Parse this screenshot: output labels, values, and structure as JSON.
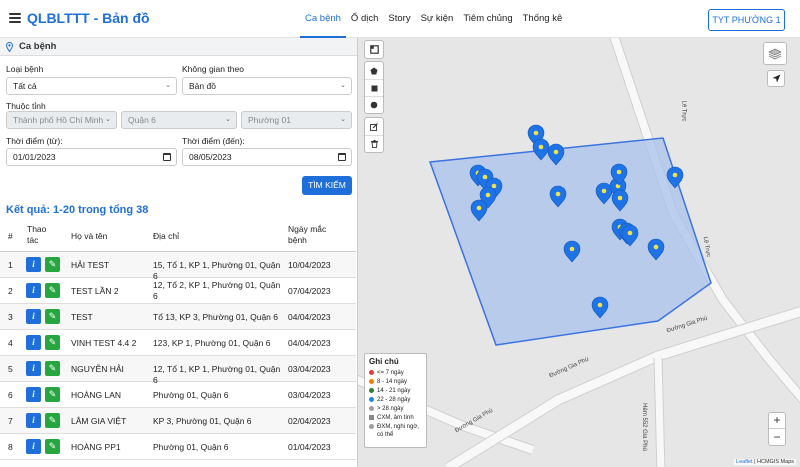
{
  "header": {
    "title": "QLBLTTT - Bản đồ",
    "nav": [
      "Ca bệnh",
      "Ổ dịch",
      "Story",
      "Sự kiện",
      "Tiêm chủng",
      "Thống kê"
    ],
    "active_tab": "Ca bệnh",
    "unit_button": "TYT PHƯỜNG 1"
  },
  "panel": {
    "title": "Ca bệnh",
    "loai_benh_label": "Loại bệnh",
    "loai_benh_value": "Tất cả",
    "khong_gian_label": "Không gian theo",
    "khong_gian_value": "Bản đồ",
    "tinh_label": "Thuộc tỉnh",
    "tinh_value": "Thành phố Hồ Chí Minh",
    "quan_value": "Quận 6",
    "phuong_value": "Phường 01",
    "tu_label": "Thời điểm (từ):",
    "tu_value": "01/01/2023",
    "den_label": "Thời điểm (đến):",
    "den_value": "08/05/2023",
    "search_button": "TÌM KIẾM",
    "result_text": "Kết quả: 1-20 trong tổng 38"
  },
  "table": {
    "headers": {
      "num": "#",
      "action_1": "Thao",
      "action_2": "tác",
      "name": "Họ và tên",
      "address": "Địa chỉ",
      "date_1": "Ngày mắc",
      "date_2": "bệnh"
    },
    "rows": [
      {
        "num": "1",
        "name": "HẢI TEST",
        "address": "15, Tổ 1, KP 1, Phường 01, Quận 6",
        "address2": "",
        "date": "10/04/2023"
      },
      {
        "num": "2",
        "name": "TEST LẦN 2",
        "address": "12, Tổ 2, KP 1, Phường 01, Quận",
        "address2": "6",
        "date": "07/04/2023"
      },
      {
        "num": "3",
        "name": "TEST",
        "address": "Tổ 13, KP 3, Phường 01, Quận 6",
        "address2": "",
        "date": "04/04/2023"
      },
      {
        "num": "4",
        "name": "VINH TEST 4.4 2",
        "address": "123, KP 1, Phường 01, Quận 6",
        "address2": "",
        "date": "04/04/2023"
      },
      {
        "num": "5",
        "name": "NGUYỄN HẢI",
        "address": "12, Tổ 1, KP 1, Phường 01, Quận 6",
        "address2": "",
        "date": "03/04/2023"
      },
      {
        "num": "6",
        "name": "HOÀNG LAN",
        "address": "Phường 01, Quận 6",
        "address2": "",
        "date": "03/04/2023"
      },
      {
        "num": "7",
        "name": "LÂM GIA VIỆT",
        "address": "KP 3, Phường 01, Quận 6",
        "address2": "",
        "date": "02/04/2023"
      },
      {
        "num": "8",
        "name": "HOÀNG PP1",
        "address": "Phường 01, Quận 6",
        "address2": "",
        "date": "01/04/2023"
      }
    ]
  },
  "map": {
    "streets": {
      "le_truc_1": "Lê Trực",
      "le_truc_2": "Lê Trực",
      "gia_phu_1": "Đường Gia Phú",
      "gia_phu_2": "Đường Gia Phú",
      "gia_phu_3": "Đường Gia Phú",
      "hem": "Hẻm 552 Gia Phú"
    },
    "legend": {
      "title": "Ghi chú",
      "items": [
        {
          "label": "<= 7 ngày",
          "color": "#e53935"
        },
        {
          "label": "8 - 14 ngày",
          "color": "#f57c00"
        },
        {
          "label": "14 - 21 ngày",
          "color": "#2e7d32"
        },
        {
          "label": "22 - 28 ngày",
          "color": "#1e88e5"
        },
        {
          "label": "> 28 ngày",
          "color": "#9e9e9e"
        }
      ],
      "extra_1": "CXM, âm tính",
      "extra_2": "ĐXM, nghi ngờ, có thể"
    },
    "attribution_link": "Leaflet",
    "attribution_text": "| HCMGIS Maps",
    "zoom_in": "+",
    "zoom_out": "−"
  },
  "colors": {
    "primary": "#1e6fd9",
    "edit": "#27a640",
    "polygon_fill": "#a9c1ec",
    "polygon_stroke": "#3b73e0",
    "marker": "#1e73e6",
    "marker_dot": "#f4e14a"
  }
}
